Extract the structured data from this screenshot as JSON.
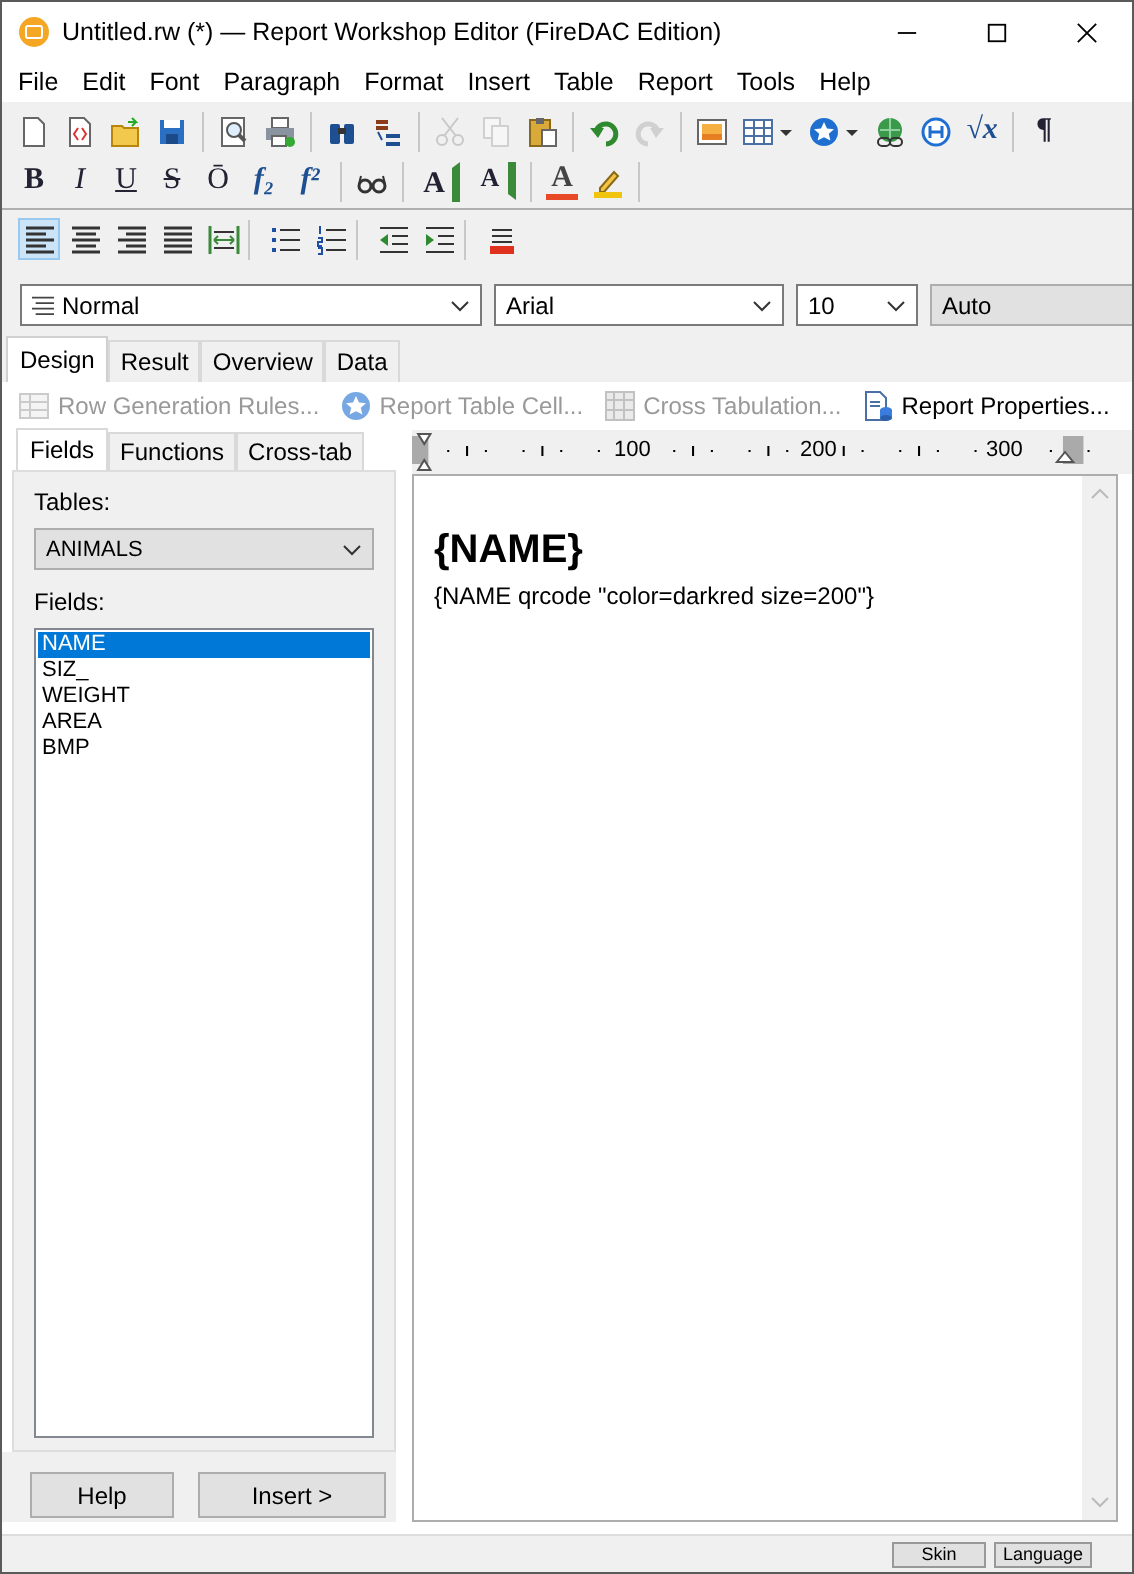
{
  "window": {
    "title": "Untitled.rw (*) — Report Workshop Editor (FireDAC Edition)"
  },
  "menu": [
    "File",
    "Edit",
    "Font",
    "Paragraph",
    "Format",
    "Insert",
    "Table",
    "Report",
    "Tools",
    "Help"
  ],
  "toolbar_1": [
    {
      "kind": "new",
      "disabled": false
    },
    {
      "kind": "template",
      "disabled": false
    },
    {
      "kind": "open",
      "disabled": false
    },
    {
      "kind": "save",
      "disabled": false
    },
    {
      "kind": "separator"
    },
    {
      "kind": "preview",
      "disabled": false
    },
    {
      "kind": "print",
      "disabled": false
    },
    {
      "kind": "separator"
    },
    {
      "kind": "find",
      "disabled": false
    },
    {
      "kind": "spell",
      "disabled": false
    },
    {
      "kind": "separator"
    },
    {
      "kind": "cut",
      "disabled": true
    },
    {
      "kind": "copy",
      "disabled": true
    },
    {
      "kind": "paste",
      "disabled": false
    },
    {
      "kind": "separator"
    },
    {
      "kind": "undo",
      "disabled": false
    },
    {
      "kind": "redo",
      "disabled": true
    },
    {
      "kind": "separator"
    },
    {
      "kind": "image",
      "disabled": false
    },
    {
      "kind": "table",
      "disabled": false,
      "dropdown": true
    },
    {
      "kind": "star",
      "disabled": false,
      "dropdown": true
    },
    {
      "kind": "hyperlink",
      "disabled": false
    },
    {
      "kind": "field",
      "disabled": false
    },
    {
      "kind": "formula",
      "glyph": "√x",
      "disabled": false
    },
    {
      "kind": "separator"
    },
    {
      "kind": "pilcrow",
      "glyph": "¶",
      "disabled": false
    }
  ],
  "toolbar_2": [
    {
      "kind": "bold",
      "glyph": "B",
      "disabled": false
    },
    {
      "kind": "italic",
      "glyph": "I",
      "disabled": false
    },
    {
      "kind": "underline",
      "glyph": "U",
      "disabled": false
    },
    {
      "kind": "strike",
      "glyph": "S",
      "disabled": false
    },
    {
      "kind": "overline",
      "glyph": "Ō",
      "disabled": false
    },
    {
      "kind": "subscript",
      "glyph": "f₂",
      "disabled": false
    },
    {
      "kind": "superscript",
      "glyph": "f²",
      "disabled": false
    },
    {
      "kind": "separator"
    },
    {
      "kind": "glasses",
      "disabled": false
    },
    {
      "kind": "separator"
    },
    {
      "kind": "grow",
      "glyph": "A",
      "disabled": false
    },
    {
      "kind": "shrink",
      "glyph": "A",
      "disabled": false
    },
    {
      "kind": "separator"
    },
    {
      "kind": "font-color",
      "glyph": "A",
      "disabled": false
    },
    {
      "kind": "highlight",
      "disabled": false
    },
    {
      "kind": "separator"
    }
  ],
  "toolbar_3": [
    {
      "kind": "align-left",
      "selected": true
    },
    {
      "kind": "align-center",
      "selected": false
    },
    {
      "kind": "align-right",
      "selected": false
    },
    {
      "kind": "justify",
      "selected": false
    },
    {
      "kind": "fit",
      "selected": false
    },
    {
      "kind": "separator"
    },
    {
      "kind": "bullets",
      "selected": false
    },
    {
      "kind": "numbering",
      "selected": false
    },
    {
      "kind": "separator"
    },
    {
      "kind": "outdent",
      "selected": false
    },
    {
      "kind": "indent",
      "selected": false
    },
    {
      "kind": "separator"
    },
    {
      "kind": "shading",
      "selected": false
    }
  ],
  "style_combo": {
    "value": "Normal"
  },
  "font_combo": {
    "value": "Arial"
  },
  "size_combo": {
    "value": "10"
  },
  "color_combo": {
    "value": "Auto"
  },
  "tabs": [
    {
      "label": "Design",
      "selected": true
    },
    {
      "label": "Result",
      "selected": false
    },
    {
      "label": "Overview",
      "selected": false
    },
    {
      "label": "Data",
      "selected": false
    }
  ],
  "report_toolbar": [
    {
      "kind": "rows",
      "label": "Row Generation Rules...",
      "disabled": true
    },
    {
      "kind": "star",
      "label": "Report Table Cell...",
      "disabled": true
    },
    {
      "kind": "crosstab",
      "label": "Cross Tabulation...",
      "disabled": true
    },
    {
      "kind": "properties",
      "label": "Report Properties...",
      "disabled": false
    }
  ],
  "side_tabs": [
    {
      "label": "Fields",
      "selected": true
    },
    {
      "label": "Functions",
      "selected": false
    },
    {
      "label": "Cross-tab",
      "selected": false
    }
  ],
  "tables": {
    "label": "Tables:",
    "value": "ANIMALS"
  },
  "fields": {
    "label": "Fields:",
    "items": [
      {
        "label": "NAME",
        "selected": true
      },
      {
        "label": "SIZ_",
        "selected": false
      },
      {
        "label": "WEIGHT",
        "selected": false
      },
      {
        "label": "AREA",
        "selected": false
      },
      {
        "label": "BMP",
        "selected": false
      }
    ]
  },
  "side_buttons": [
    "Help",
    "Insert >"
  ],
  "ruler": {
    "labels": [
      "100",
      "200",
      "300"
    ]
  },
  "document": {
    "heading": "{NAME}",
    "body": "{NAME qrcode \"color=darkred size=200\"}"
  },
  "status_bar": {
    "buttons": [
      "Skin",
      "Language"
    ]
  }
}
